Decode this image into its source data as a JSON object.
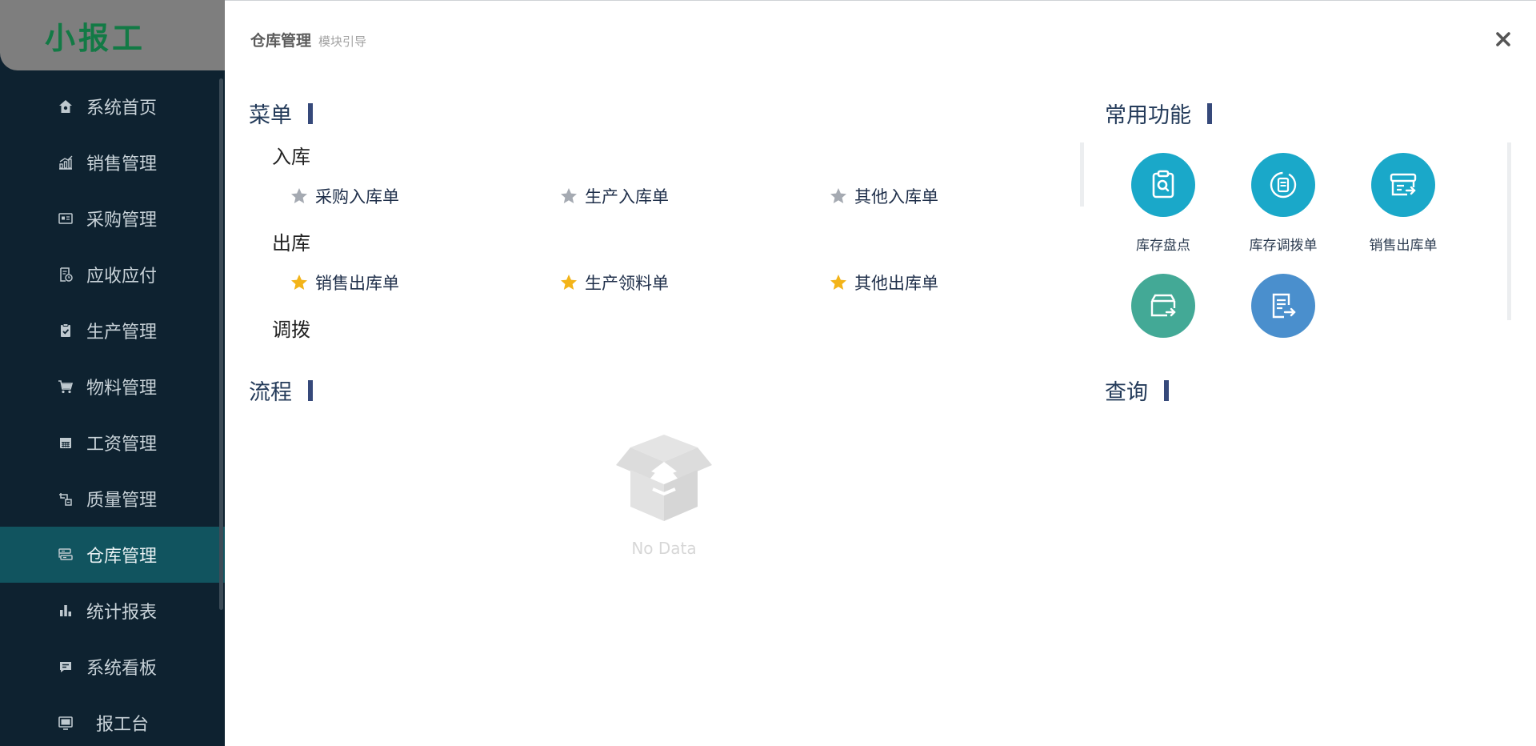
{
  "app": {
    "logo": "小报工"
  },
  "sidebar": {
    "items": [
      {
        "label": "系统首页",
        "icon": "home-icon"
      },
      {
        "label": "销售管理",
        "icon": "chart-icon"
      },
      {
        "label": "采购管理",
        "icon": "card-icon"
      },
      {
        "label": "应收应付",
        "icon": "invoice-icon"
      },
      {
        "label": "生产管理",
        "icon": "clipboard-check-icon"
      },
      {
        "label": "物料管理",
        "icon": "cart-icon"
      },
      {
        "label": "工资管理",
        "icon": "calendar-icon"
      },
      {
        "label": "质量管理",
        "icon": "quality-icon"
      },
      {
        "label": "仓库管理",
        "icon": "warehouse-icon",
        "active": true
      },
      {
        "label": "统计报表",
        "icon": "bar-chart-icon"
      },
      {
        "label": "系统看板",
        "icon": "board-icon"
      },
      {
        "label": "报工台",
        "icon": "monitor-icon"
      }
    ]
  },
  "panel": {
    "title": "仓库管理",
    "subtitle": "模块引导"
  },
  "sections": {
    "menu": "菜单",
    "common": "常用功能",
    "process": "流程",
    "query": "查询"
  },
  "menu": {
    "groups": [
      {
        "title": "入库",
        "items": [
          {
            "label": "采购入库单"
          },
          {
            "label": "生产入库单"
          },
          {
            "label": "其他入库单"
          }
        ]
      },
      {
        "title": "出库",
        "items": [
          {
            "label": "销售出库单"
          },
          {
            "label": "生产领料单"
          },
          {
            "label": "其他出库单"
          }
        ]
      },
      {
        "title": "调拨",
        "items": []
      }
    ]
  },
  "common_functions": [
    {
      "label": "库存盘点",
      "color": "#1aa8c9",
      "icon": "inventory-check-icon"
    },
    {
      "label": "库存调拨单",
      "color": "#1aa8c9",
      "icon": "transfer-icon"
    },
    {
      "label": "销售出库单",
      "color": "#1aa8c9",
      "icon": "box-out-icon"
    },
    {
      "label": "",
      "color": "#43a996",
      "icon": "box-out-icon"
    },
    {
      "label": "",
      "color": "#4a8fcd",
      "icon": "document-out-icon"
    }
  ],
  "empty_state": {
    "text": "No Data",
    "icon": "empty-box-icon"
  },
  "colors": {
    "sidebar_bg": "#0e2230",
    "active_item": "#11545f",
    "logo_text": "#127a45",
    "star_grey": "#a5aab2",
    "star_gold": "#f3b419",
    "section_bar": "#36497a"
  }
}
